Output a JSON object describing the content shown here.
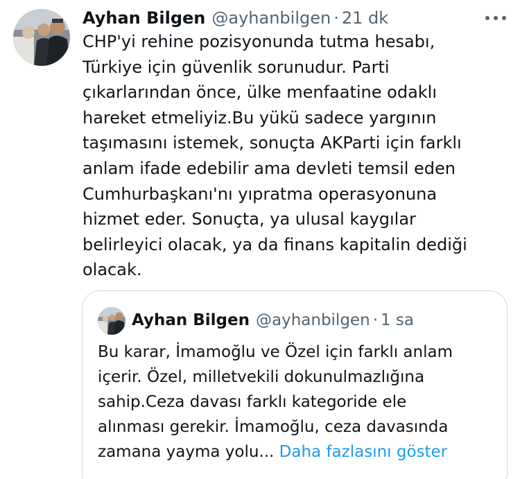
{
  "tweet": {
    "display_name": "Ayhan Bilgen",
    "handle": "@ayhanbilgen",
    "separator": "·",
    "time": "21 dk",
    "more_icon": "more-horizontal-icon",
    "text_lines": [
      "CHP'yi rehine pozisyonunda tutma hesabı,",
      "Türkiye için güvenlik sorunudur. Parti",
      "çıkarlarından önce, ülke menfaatine odaklı",
      "hareket etmeliyiz.Bu yükü sadece  yargının",
      "taşımasını istemek, sonuçta AKParti için farklı",
      "anlam ifade edebilir ama devleti temsil eden",
      "Cumhurbaşkanı'nı yıpratma operasyonuna",
      "hizmet eder. Sonuçta, ya ulusal kaygılar",
      "belirleyici olacak, ya da finans kapitalin dediği",
      "olacak."
    ]
  },
  "quote": {
    "display_name": "Ayhan Bilgen",
    "handle": "@ayhanbilgen",
    "separator": "·",
    "time": "1 sa",
    "text_lines": [
      "Bu karar, İmamoğlu ve Özel için farklı anlam",
      "içerir. Özel, milletvekili dokunulmazlığına",
      "sahip.Ceza davası farklı kategoride ele",
      "alınması gerekir. İmamoğlu, ceza davasında"
    ],
    "last_line_text": "zamana yayma yolu... ",
    "show_more": "Daha fazlasını göster"
  },
  "colors": {
    "text_primary": "#0f1419",
    "text_secondary": "#536471",
    "link": "#1d9bf0",
    "border": "#cfd9de"
  }
}
